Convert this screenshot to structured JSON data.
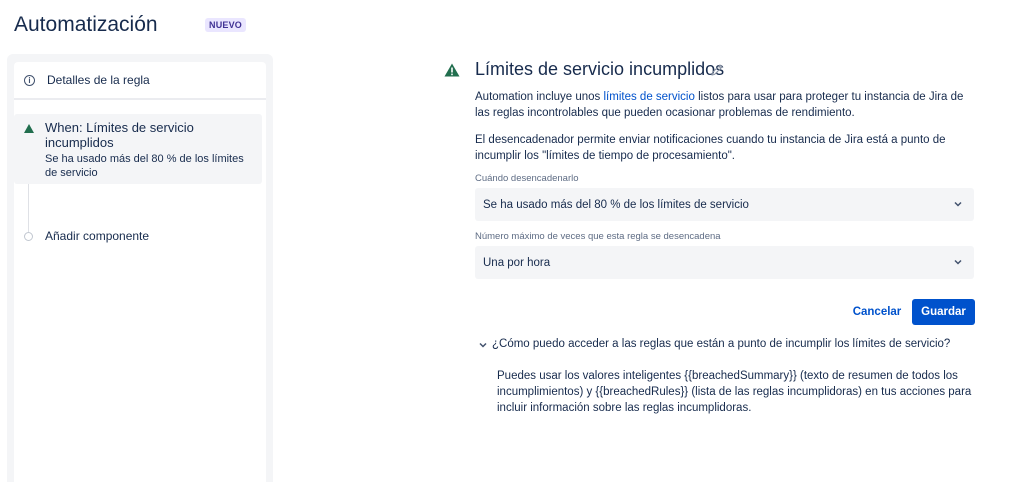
{
  "header": {
    "title": "Automatización",
    "badge": "NUEVO"
  },
  "sidebar": {
    "rule_details_label": "Detalles de la regla",
    "trigger": {
      "title": "When: Límites de servicio incumplidos",
      "subtitle": "Se ha usado más del 80 % de los límites de servicio"
    },
    "add_component_label": "Añadir componente"
  },
  "main": {
    "title": "Límites de servicio incumplidos",
    "para1_before": "Automation incluye unos ",
    "para1_link": "límites de servicio",
    "para1_after": " listos para usar para proteger tu instancia de Jira de las reglas incontrolables que pueden ocasionar problemas de rendimiento.",
    "para2": "El desencadenador permite enviar notificaciones cuando tu instancia de Jira está a punto de incumplir los \"límites de tiempo de procesamiento\".",
    "field1": {
      "label": "Cuándo desencadenarlo",
      "value": "Se ha usado más del 80 % de los límites de servicio"
    },
    "field2": {
      "label": "Número máximo de veces que esta regla se desencadena",
      "value": "Una por hora"
    },
    "cancel_label": "Cancelar",
    "save_label": "Guardar",
    "faq": {
      "question": "¿Cómo puedo acceder a las reglas que están a punto de incumplir los límites de servicio?",
      "answer": "Puedes usar los valores inteligentes {{breachedSummary}} (texto de resumen de todos los incumplimientos) y {{breachedRules}} (lista de las reglas incumplidoras) en tus acciones para incluir información sobre las reglas incumplidoras."
    }
  },
  "colors": {
    "accent": "#0052cc",
    "trigger_green": "#216e4e",
    "panel_bg": "#f4f5f7",
    "badge_bg": "#eae6ff"
  },
  "icons": {
    "rule_details": "info-icon",
    "trigger": "warning-triangle-icon",
    "edit": "pencil-icon",
    "select": "chevron-down-icon"
  }
}
